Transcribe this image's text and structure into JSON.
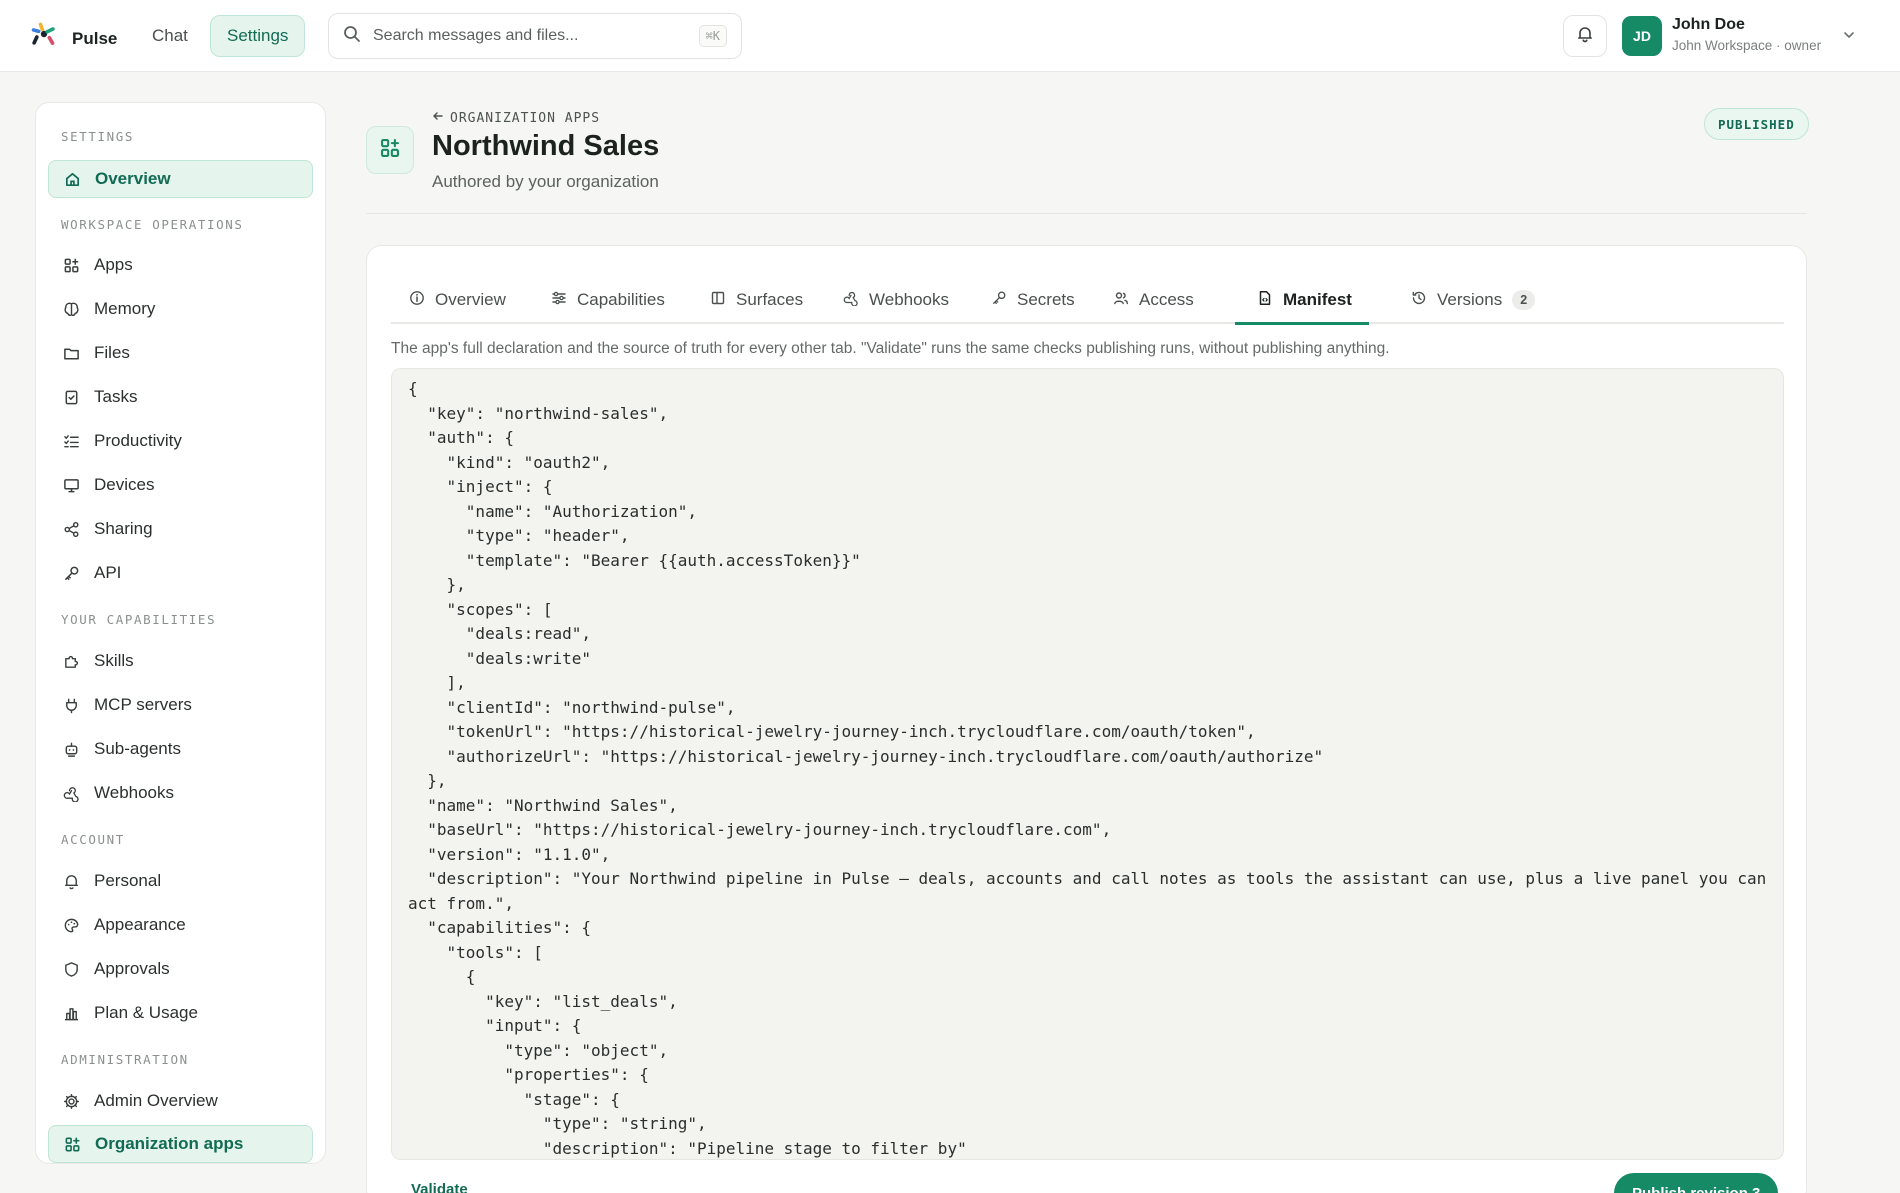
{
  "topbar": {
    "brand": "Pulse",
    "nav_chat": "Chat",
    "nav_settings": "Settings",
    "search_placeholder": "Search messages and files...",
    "search_shortcut": "⌘K",
    "user_initials": "JD",
    "user_name": "John Doe",
    "user_subtitle": "John Workspace · owner"
  },
  "sidebar": {
    "section_settings": "SETTINGS",
    "overview": "Overview",
    "section_workspace": "WORKSPACE OPERATIONS",
    "workspace_items": [
      "Apps",
      "Memory",
      "Files",
      "Tasks",
      "Productivity",
      "Devices",
      "Sharing",
      "API"
    ],
    "section_capabilities": "YOUR CAPABILITIES",
    "capability_items": [
      "Skills",
      "MCP servers",
      "Sub-agents",
      "Webhooks"
    ],
    "section_account": "ACCOUNT",
    "account_items": [
      "Personal",
      "Appearance",
      "Approvals",
      "Plan & Usage"
    ],
    "section_admin": "ADMINISTRATION",
    "admin_items": [
      "Admin Overview",
      "Organization apps"
    ]
  },
  "app_header": {
    "back_label": "ORGANIZATION APPS",
    "title": "Northwind Sales",
    "subtitle": "Authored by your organization",
    "status": "PUBLISHED"
  },
  "tabs": [
    {
      "label": "Overview"
    },
    {
      "label": "Capabilities"
    },
    {
      "label": "Surfaces"
    },
    {
      "label": "Webhooks"
    },
    {
      "label": "Secrets"
    },
    {
      "label": "Access"
    },
    {
      "label": "Manifest"
    },
    {
      "label": "Versions",
      "badge": "2"
    }
  ],
  "manifest": {
    "description": "The app's full declaration and the source of truth for every other tab. \"Validate\" runs the same checks publishing runs, without publishing anything.",
    "code": "{\n  \"key\": \"northwind-sales\",\n  \"auth\": {\n    \"kind\": \"oauth2\",\n    \"inject\": {\n      \"name\": \"Authorization\",\n      \"type\": \"header\",\n      \"template\": \"Bearer {{auth.accessToken}}\"\n    },\n    \"scopes\": [\n      \"deals:read\",\n      \"deals:write\"\n    ],\n    \"clientId\": \"northwind-pulse\",\n    \"tokenUrl\": \"https://historical-jewelry-journey-inch.trycloudflare.com/oauth/token\",\n    \"authorizeUrl\": \"https://historical-jewelry-journey-inch.trycloudflare.com/oauth/authorize\"\n  },\n  \"name\": \"Northwind Sales\",\n  \"baseUrl\": \"https://historical-jewelry-journey-inch.trycloudflare.com\",\n  \"version\": \"1.1.0\",\n  \"description\": \"Your Northwind pipeline in Pulse — deals, accounts and call notes as tools the assistant can use, plus a live panel you can act from.\",\n  \"capabilities\": {\n    \"tools\": [\n      {\n        \"key\": \"list_deals\",\n        \"input\": {\n          \"type\": \"object\",\n          \"properties\": {\n            \"stage\": {\n              \"type\": \"string\",\n              \"description\": \"Pipeline stage to filter by\"",
    "validate_label": "Validate",
    "publish_label": "Publish revision 3"
  }
}
